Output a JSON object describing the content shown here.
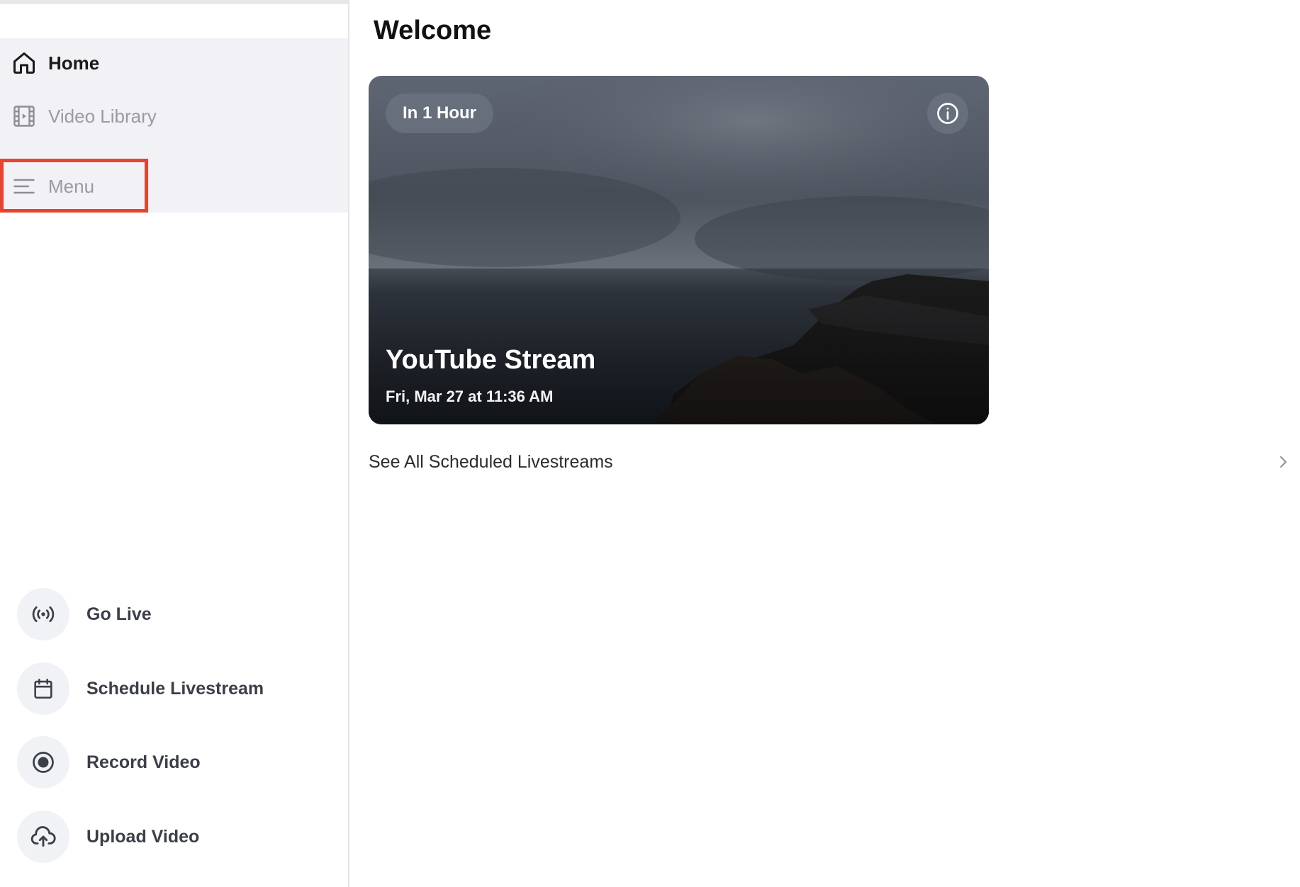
{
  "sidebar": {
    "nav": {
      "home": "Home",
      "video_library": "Video Library",
      "menu": "Menu"
    },
    "actions": {
      "go_live": "Go Live",
      "schedule_livestream": "Schedule Livestream",
      "record_video": "Record Video",
      "upload_video": "Upload Video"
    },
    "icons": {
      "home": "home-icon",
      "video_library": "film-icon",
      "menu": "hamburger-icon",
      "go_live": "broadcast-icon",
      "schedule": "calendar-icon",
      "record": "record-icon",
      "upload": "cloud-upload-icon"
    }
  },
  "main": {
    "title": "Welcome",
    "stream_card": {
      "badge": "In 1 Hour",
      "title": "YouTube Stream",
      "subtitle": "Fri, Mar 27 at 11:36 AM"
    },
    "see_all": "See All Scheduled Livestreams"
  },
  "colors": {
    "highlight": "#e8432e",
    "nav_bg": "#f1f1f6",
    "action_circle": "#f1f2f6"
  }
}
